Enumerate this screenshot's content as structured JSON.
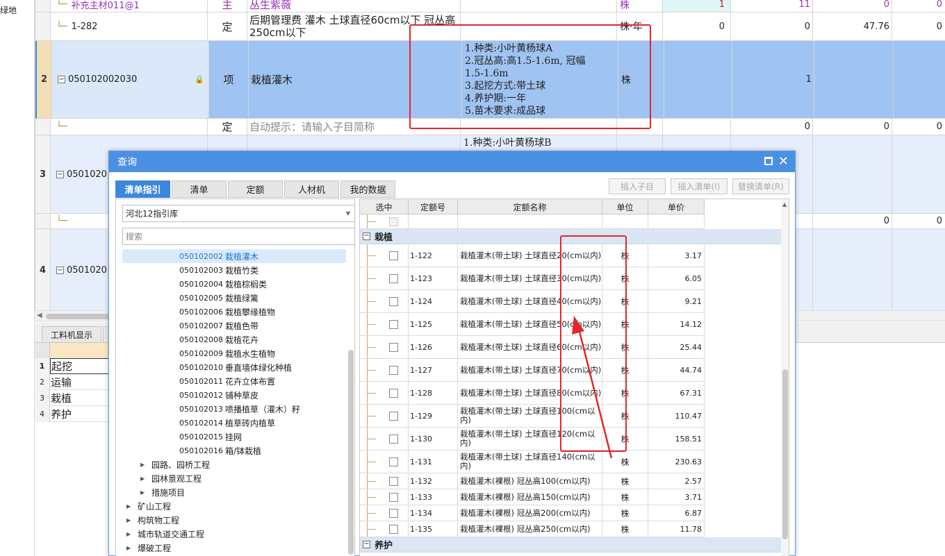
{
  "left_strip": {
    "label": "绿地"
  },
  "grid": {
    "rows": [
      {
        "num": "",
        "code": "补充主材011@1",
        "type": "主",
        "name": "丛生紫薇",
        "features": "",
        "unit": "株",
        "q1": "1",
        "q2": "11",
        "q3": "0",
        "q4": "0"
      },
      {
        "num": "",
        "code": "1-282",
        "type": "定",
        "name": "后期管理费 灌木 土球直径60cm以下 冠丛高250cm以下",
        "features": "",
        "unit": "株·年",
        "q1": "0",
        "q2": "0",
        "q3": "47.76",
        "q4": "0"
      },
      {
        "num": "2",
        "code": "050102002030",
        "type": "项",
        "name": "栽植灌木",
        "features": "1.种类:小叶黄杨球A\n2.冠丛高:高1.5-1.6m, 冠幅\n1.5-1.6m\n3.起挖方式:带土球\n4.养护期:一年\n5.苗木要求:成品球",
        "unit": "株",
        "q1": "",
        "q2": "1",
        "q3": "",
        "q4": ""
      },
      {
        "num": "",
        "code": "",
        "type": "定",
        "name": "自动提示：请输入子目简称",
        "features": "",
        "unit": "",
        "q1": "",
        "q2": "0",
        "q3": "0",
        "q4": "0"
      },
      {
        "num": "3",
        "code": "0501020",
        "type": "",
        "name": "",
        "features": "1.种类:小叶黄杨球B",
        "unit": "",
        "q1": "",
        "q2": "",
        "q3": "",
        "q4": ""
      },
      {
        "num": "",
        "code": "",
        "type": "",
        "name": "",
        "features": "",
        "unit": "",
        "q1": "",
        "q2": "",
        "q3": "0",
        "q4": "0"
      },
      {
        "num": "4",
        "code": "0501020",
        "type": "",
        "name": "",
        "features": "",
        "unit": "",
        "q1": "",
        "q2": "",
        "q3": "",
        "q4": ""
      }
    ]
  },
  "bottom_panel": {
    "tab_label": "工料机显示",
    "rows": [
      {
        "num": "1",
        "value": "起挖"
      },
      {
        "num": "2",
        "value": "运输"
      },
      {
        "num": "3",
        "value": "栽植"
      },
      {
        "num": "4",
        "value": "养护"
      }
    ]
  },
  "dialog": {
    "title": "查询",
    "tabs": [
      "清单指引",
      "清单",
      "定额",
      "人材机",
      "我的数据"
    ],
    "actions": [
      "插入子目",
      "插入清单(I)",
      "替换清单(R)"
    ],
    "library": "河北12指引库",
    "search_placeholder": "搜索",
    "tree_items": [
      {
        "code": "050102002",
        "name": "栽植灌木"
      },
      {
        "code": "050102003",
        "name": "栽植竹类"
      },
      {
        "code": "050102004",
        "name": "栽植棕榈类"
      },
      {
        "code": "050102005",
        "name": "栽植绿篱"
      },
      {
        "code": "050102006",
        "name": "栽植攀缘植物"
      },
      {
        "code": "050102007",
        "name": "栽植色带"
      },
      {
        "code": "050102008",
        "name": "栽植花卉"
      },
      {
        "code": "050102009",
        "name": "栽植水生植物"
      },
      {
        "code": "050102010",
        "name": "垂直墙体绿化种植"
      },
      {
        "code": "050102011",
        "name": "花卉立体布置"
      },
      {
        "code": "050102012",
        "name": "铺种草皮"
      },
      {
        "code": "050102013",
        "name": "喷播植草（灌木）籽"
      },
      {
        "code": "050102014",
        "name": "植草砖内植草"
      },
      {
        "code": "050102015",
        "name": "挂网"
      },
      {
        "code": "050102016",
        "name": "箱/钵栽植"
      }
    ],
    "tree_groups_sub": [
      "园路、园桥工程",
      "园林景观工程",
      "措施项目"
    ],
    "tree_groups_top": [
      "矿山工程",
      "构筑物工程",
      "城市轨道交通工程",
      "爆破工程"
    ],
    "columns": [
      "选中",
      "定额号",
      "定额名称",
      "单位",
      "单价"
    ],
    "group1": "栽植",
    "group2": "养护",
    "quotas": [
      {
        "code": "1-122",
        "name": "栽植灌木(带土球) 土球直径20(cm以内)",
        "unit": "株",
        "price": "3.17"
      },
      {
        "code": "1-123",
        "name": "栽植灌木(带土球) 土球直径30(cm以内)",
        "unit": "株",
        "price": "6.05"
      },
      {
        "code": "1-124",
        "name": "栽植灌木(带土球) 土球直径40(cm以内)",
        "unit": "株",
        "price": "9.21"
      },
      {
        "code": "1-125",
        "name": "栽植灌木(带土球) 土球直径50(cm以内)",
        "unit": "株",
        "price": "14.12"
      },
      {
        "code": "1-126",
        "name": "栽植灌木(带土球) 土球直径60(cm以内)",
        "unit": "株",
        "price": "25.44"
      },
      {
        "code": "1-127",
        "name": "栽植灌木(带土球) 土球直径70(cm以内)",
        "unit": "株",
        "price": "44.74"
      },
      {
        "code": "1-128",
        "name": "栽植灌木(带土球) 土球直径80(cm以内)",
        "unit": "株",
        "price": "67.31"
      },
      {
        "code": "1-129",
        "name": "栽植灌木(带土球) 土球直径100(cm以内)",
        "unit": "株",
        "price": "110.47"
      },
      {
        "code": "1-130",
        "name": "栽植灌木(带土球) 土球直径120(cm以内)",
        "unit": "株",
        "price": "158.51"
      },
      {
        "code": "1-131",
        "name": "栽植灌木(带土球) 土球直径140(cm以内)",
        "unit": "株",
        "price": "230.63"
      },
      {
        "code": "1-132",
        "name": "栽植灌木(裸根) 冠丛高100(cm以内)",
        "unit": "株",
        "price": "2.57"
      },
      {
        "code": "1-133",
        "name": "栽植灌木(裸根) 冠丛高150(cm以内)",
        "unit": "株",
        "price": "3.71"
      },
      {
        "code": "1-134",
        "name": "栽植灌木(裸根) 冠丛高200(cm以内)",
        "unit": "株",
        "price": "6.87"
      },
      {
        "code": "1-135",
        "name": "栽植灌木(裸根) 冠丛高250(cm以内)",
        "unit": "株",
        "price": "11.78"
      }
    ]
  },
  "colors": {
    "accent": "#4a90e2",
    "selected_row": "#9fc3f2",
    "annotation": "#e5262c"
  }
}
